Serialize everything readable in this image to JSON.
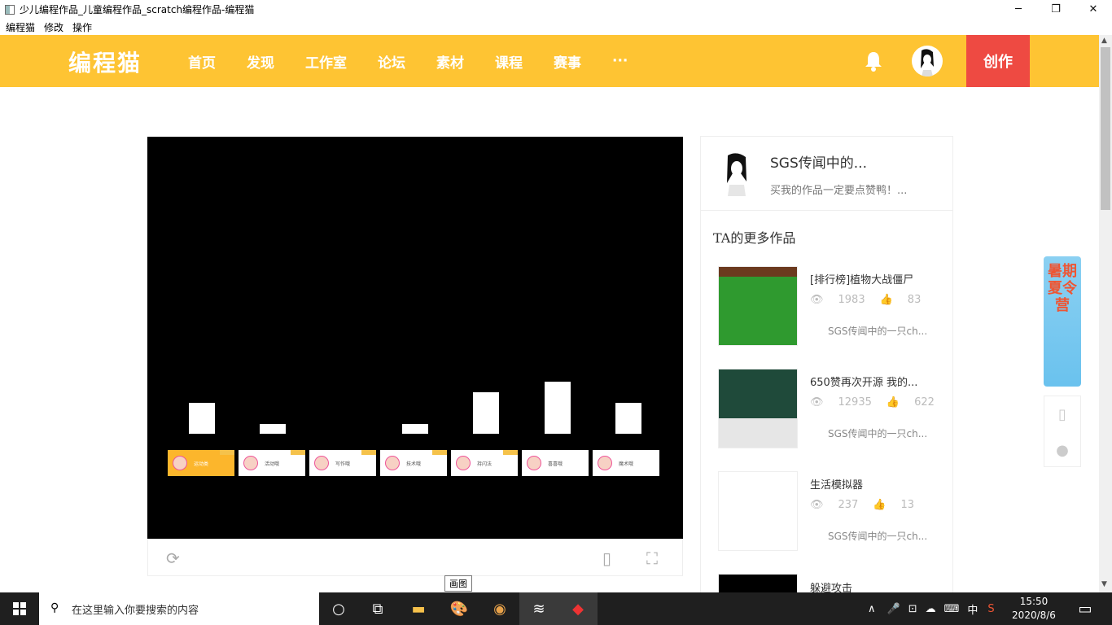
{
  "window": {
    "title": "少儿编程作品_儿童编程作品_scratch编程作品-编程猫",
    "minimize": "─",
    "maximize": "❐",
    "close": "✕"
  },
  "menu": [
    "编程猫",
    "修改",
    "操作"
  ],
  "header": {
    "logo": "编程猫",
    "nav": [
      "首页",
      "发现",
      "工作室",
      "论坛",
      "素材",
      "课程",
      "赛事",
      "···"
    ],
    "create": "创作"
  },
  "stage": {
    "bars": [
      {
        "value": 38
      },
      {
        "value": 12
      },
      {
        "value": 0
      },
      {
        "value": 12
      },
      {
        "value": 51
      },
      {
        "value": 64
      },
      {
        "value": 38
      }
    ],
    "cards": [
      "运动类",
      "活动哦",
      "写作哦",
      "技术哦",
      "持闪法",
      "喜喜哦",
      "魔术哦"
    ]
  },
  "profile": {
    "name": "SGS传闻中的...",
    "desc": "买我的作品一定要点赞鸭！..."
  },
  "more": {
    "title": "TA的更多作品",
    "works": [
      {
        "title": "[排行榜]植物大战僵尸",
        "views": "1983",
        "likes": "83",
        "author": "SGS传闻中的一只ch..."
      },
      {
        "title": "650赞再次开源 我的...",
        "views": "12935",
        "likes": "622",
        "author": "SGS传闻中的一只ch..."
      },
      {
        "title": "生活模拟器",
        "views": "237",
        "likes": "13",
        "author": "SGS传闻中的一只ch..."
      },
      {
        "title": "躲避攻击",
        "views": "",
        "likes": "",
        "author": ""
      }
    ]
  },
  "ad": {
    "text": "暑期夏令营"
  },
  "tooltip": "画图",
  "taskbar": {
    "search_placeholder": "在这里输入你要搜索的内容",
    "ime": "中",
    "time": "15:50",
    "date": "2020/8/6"
  }
}
